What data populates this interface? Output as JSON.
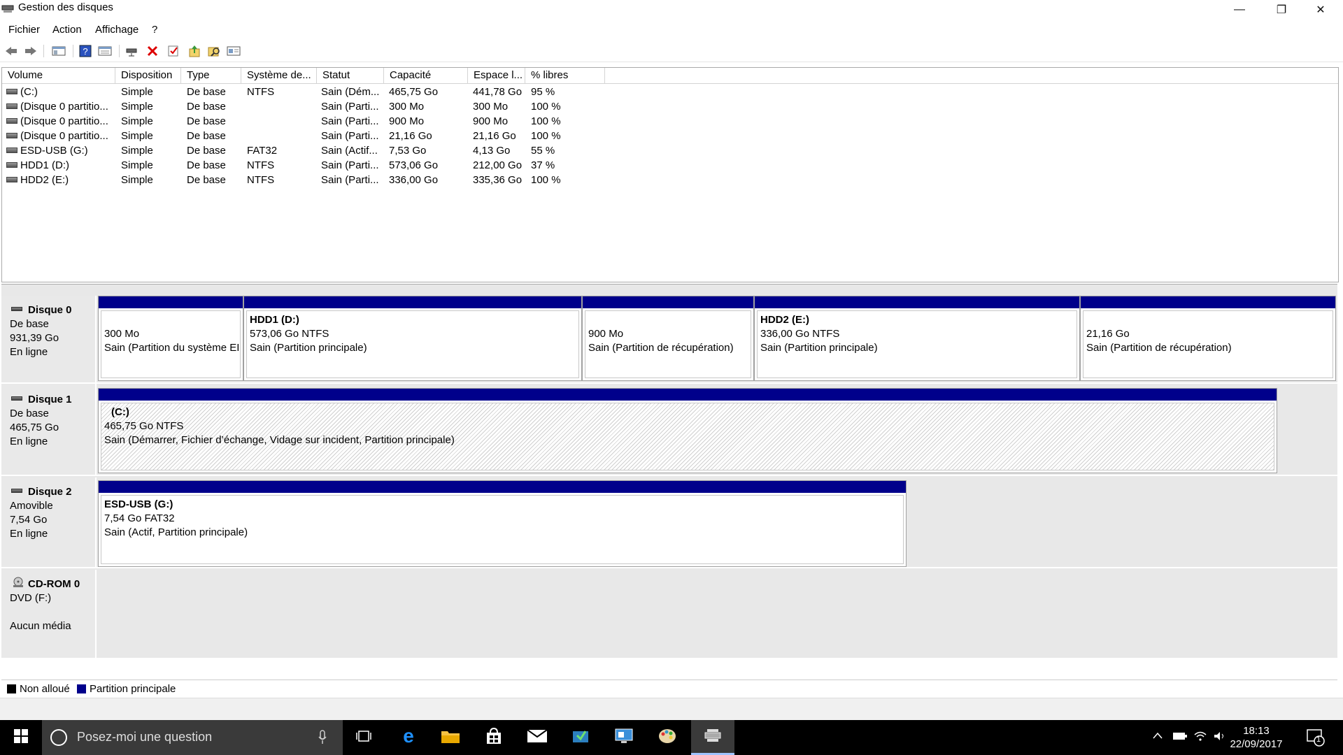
{
  "window": {
    "title": "Gestion des disques",
    "controls": [
      "—",
      "❐",
      "✕"
    ]
  },
  "menu": [
    "Fichier",
    "Action",
    "Affichage",
    "?"
  ],
  "toolbar": [
    "back-icon",
    "forward-icon",
    "console-tree-icon",
    "help-icon",
    "properties-icon",
    "connect-icon",
    "delete-icon",
    "check-icon",
    "import-icon",
    "search-icon",
    "view-icon"
  ],
  "volume_list": {
    "columns": [
      "Volume",
      "Disposition",
      "Type",
      "Système de...",
      "Statut",
      "Capacité",
      "Espace l...",
      "% libres"
    ],
    "rows": [
      [
        "(C:)",
        "Simple",
        "De base",
        "NTFS",
        "Sain (Dém...",
        "465,75 Go",
        "441,78 Go",
        "95 %"
      ],
      [
        "(Disque 0 partitio...",
        "Simple",
        "De base",
        "",
        "Sain (Parti...",
        "300 Mo",
        "300 Mo",
        "100 %"
      ],
      [
        "(Disque 0 partitio...",
        "Simple",
        "De base",
        "",
        "Sain (Parti...",
        "900 Mo",
        "900 Mo",
        "100 %"
      ],
      [
        "(Disque 0 partitio...",
        "Simple",
        "De base",
        "",
        "Sain (Parti...",
        "21,16 Go",
        "21,16 Go",
        "100 %"
      ],
      [
        "ESD-USB (G:)",
        "Simple",
        "De base",
        "FAT32",
        "Sain (Actif...",
        "7,53 Go",
        "4,13 Go",
        "55 %"
      ],
      [
        "HDD1 (D:)",
        "Simple",
        "De base",
        "NTFS",
        "Sain (Parti...",
        "573,06 Go",
        "212,00 Go",
        "37 %"
      ],
      [
        "HDD2 (E:)",
        "Simple",
        "De base",
        "NTFS",
        "Sain (Parti...",
        "336,00 Go",
        "335,36 Go",
        "100 %"
      ]
    ]
  },
  "disks": [
    {
      "name": "Disque 0",
      "type": "De base",
      "size": "931,39 Go",
      "state": "En ligne",
      "partitions": [
        {
          "title": "",
          "size": "300 Mo",
          "status": "Sain (Partition du système EI"
        },
        {
          "title": "HDD1  (D:)",
          "size": "573,06 Go NTFS",
          "status": "Sain (Partition principale)"
        },
        {
          "title": "",
          "size": "900 Mo",
          "status": "Sain (Partition de récupération)"
        },
        {
          "title": "HDD2  (E:)",
          "size": "336,00 Go NTFS",
          "status": "Sain (Partition principale)"
        },
        {
          "title": "",
          "size": "21,16 Go",
          "status": "Sain (Partition de récupération)"
        }
      ]
    },
    {
      "name": "Disque 1",
      "type": "De base",
      "size": "465,75 Go",
      "state": "En ligne",
      "partitions": [
        {
          "title": "(C:)",
          "size": "465,75 Go NTFS",
          "status": "Sain (Démarrer, Fichier d’échange, Vidage sur incident, Partition principale)"
        }
      ]
    },
    {
      "name": "Disque 2",
      "type": "Amovible",
      "size": "7,54 Go",
      "state": "En ligne",
      "partitions": [
        {
          "title": "ESD-USB  (G:)",
          "size": "7,54 Go FAT32",
          "status": "Sain (Actif, Partition principale)"
        }
      ]
    },
    {
      "name": "CD-ROM 0",
      "type": "DVD (F:)",
      "size": "",
      "state": "Aucun média",
      "partitions": []
    }
  ],
  "legend": [
    {
      "label": "Non alloué",
      "color": "#000000"
    },
    {
      "label": "Partition principale",
      "color": "#00008b"
    }
  ],
  "taskbar": {
    "search_placeholder": "Posez-moi une question",
    "time": "18:13",
    "date": "22/09/2017",
    "notification_count": "1"
  }
}
